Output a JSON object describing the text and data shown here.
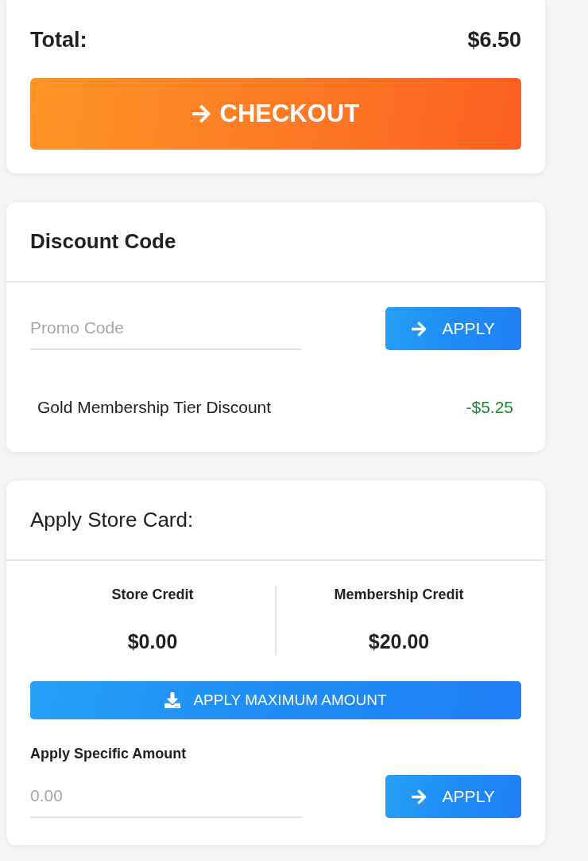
{
  "summary": {
    "total_label": "Total:",
    "total_value": "$6.50",
    "checkout_button": {
      "label": "CHECKOUT"
    }
  },
  "discount": {
    "title": "Discount Code",
    "promo_field": {
      "placeholder": "Promo Code"
    },
    "apply_button": {
      "label": "APPLY"
    },
    "discounts": [
      {
        "name": "Gold Membership Tier Discount",
        "amount": "-$5.25"
      }
    ]
  },
  "store_card": {
    "title": "Apply Store Card:",
    "credits": [
      {
        "label": "Store Credit",
        "value": "$0.00"
      },
      {
        "label": "Membership Credit",
        "value": "$20.00"
      }
    ],
    "max_button": {
      "label": "APPLY MAXIMUM AMOUNT"
    },
    "specific_label": "Apply Specific Amount",
    "amount_field": {
      "placeholder": "0.00"
    },
    "apply_button": {
      "label": "APPLY"
    }
  }
}
